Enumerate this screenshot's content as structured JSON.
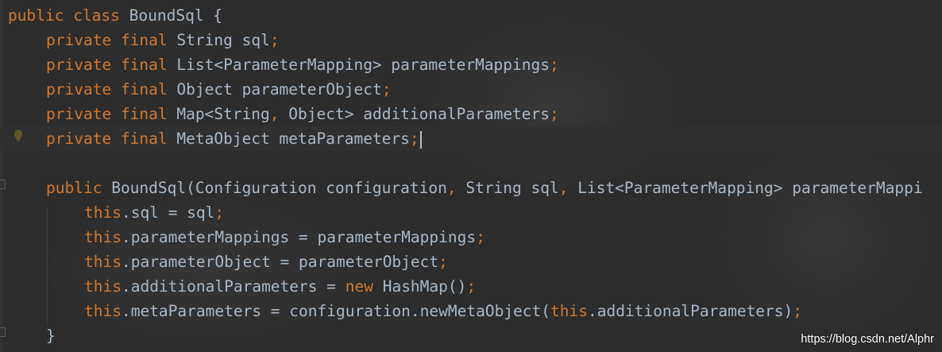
{
  "code": {
    "line1": {
      "public_kw": "public",
      "class_kw": "class",
      "rest": " BoundSql {"
    },
    "line2": {
      "private_kw": "private",
      "final_kw": "final",
      "type": "String",
      "name": "sql",
      "semi": ";"
    },
    "line3": {
      "private_kw": "private",
      "final_kw": "final",
      "type": "List<ParameterMapping>",
      "name": "parameterMappings",
      "semi": ";"
    },
    "line4": {
      "private_kw": "private",
      "final_kw": "final",
      "type": "Object",
      "name": "parameterObject",
      "semi": ";"
    },
    "line5": {
      "private_kw": "private",
      "final_kw": "final",
      "type_a": "Map<String",
      "comma": ",",
      "type_b": " Object>",
      "name": "additionalParameters",
      "semi": ";"
    },
    "line6": {
      "private_kw": "private",
      "final_kw": "final",
      "type": "MetaObject",
      "name": "metaParameters",
      "semi": ";"
    },
    "line8": {
      "public_kw": "public",
      "ctor": "BoundSql(Configuration configuration",
      "comma1": ",",
      "p2": " String sql",
      "comma2": ",",
      "p3": " List<ParameterMapping> parameterMappi"
    },
    "line9": {
      "this_kw": "this",
      "rest": ".sql = sql",
      "semi": ";"
    },
    "line10": {
      "this_kw": "this",
      "rest": ".parameterMappings = parameterMappings",
      "semi": ";"
    },
    "line11": {
      "this_kw": "this",
      "rest": ".parameterObject = parameterObject",
      "semi": ";"
    },
    "line12": {
      "this_kw": "this",
      "mid": ".additionalParameters = ",
      "new_kw": "new",
      "rest": " HashMap()",
      "semi": ";"
    },
    "line13": {
      "this_kw": "this",
      "mid": ".metaParameters = configuration.newMetaObject(",
      "this2_kw": "this",
      "rest": ".additionalParameters)",
      "semi": ";"
    },
    "line14": {
      "brace": "}"
    }
  },
  "icons": {
    "intention": "lightbulb-icon"
  },
  "colors": {
    "background": "#2d2d2d",
    "keyword": "#cc7832",
    "plain": "#a9b7c6",
    "bulb": "#f0c419"
  },
  "watermark": "https://blog.csdn.net/Alphr"
}
